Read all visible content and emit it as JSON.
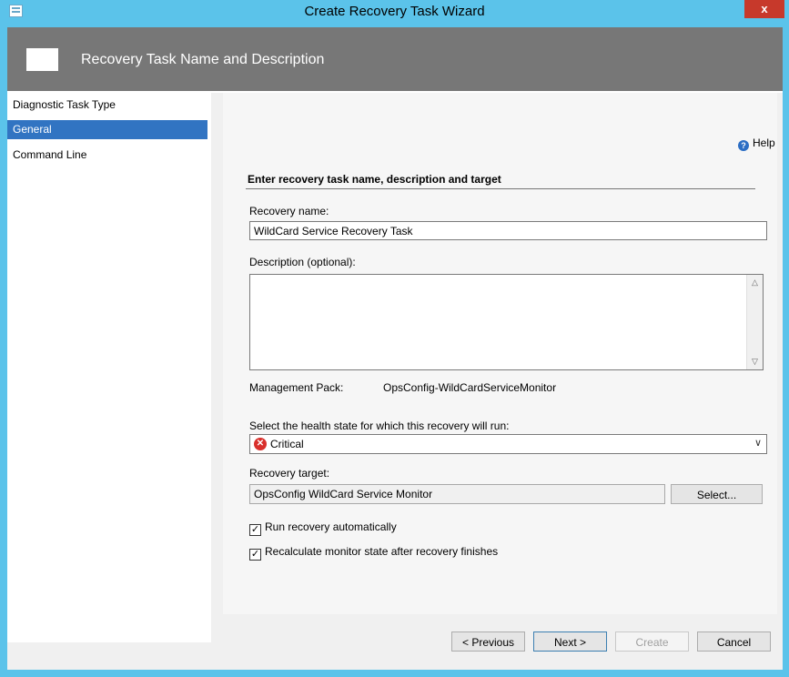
{
  "window": {
    "title": "Create Recovery Task Wizard",
    "close_label": "x"
  },
  "banner": {
    "title": "Recovery Task Name and Description"
  },
  "nav": {
    "items": [
      {
        "label": "Diagnostic Task Type",
        "selected": false
      },
      {
        "label": "General",
        "selected": true
      },
      {
        "label": "Command Line",
        "selected": false
      }
    ]
  },
  "content": {
    "help_label": "Help",
    "heading": "Enter recovery task name, description and target",
    "recovery_name_label": "Recovery name:",
    "recovery_name_value": "WildCard Service Recovery Task",
    "description_label": "Description (optional):",
    "description_value": "",
    "management_pack_label": "Management Pack:",
    "management_pack_value": "OpsConfig-WildCardServiceMonitor",
    "health_state_label": "Select the health state for which this recovery will run:",
    "health_state_value": "Critical",
    "recovery_target_label": "Recovery target:",
    "recovery_target_value": "OpsConfig WildCard Service Monitor",
    "select_button": "Select...",
    "run_automatically_label": "Run recovery automatically",
    "run_automatically_checked": true,
    "recalculate_label": "Recalculate monitor state after recovery finishes",
    "recalculate_checked": true
  },
  "footer": {
    "previous_label": "< Previous",
    "next_label": "Next >",
    "create_label": "Create",
    "cancel_label": "Cancel"
  },
  "colors": {
    "titlebar": "#5bc3ea",
    "banner": "#777777",
    "nav_selected": "#3174c2",
    "critical": "#d9302c"
  }
}
